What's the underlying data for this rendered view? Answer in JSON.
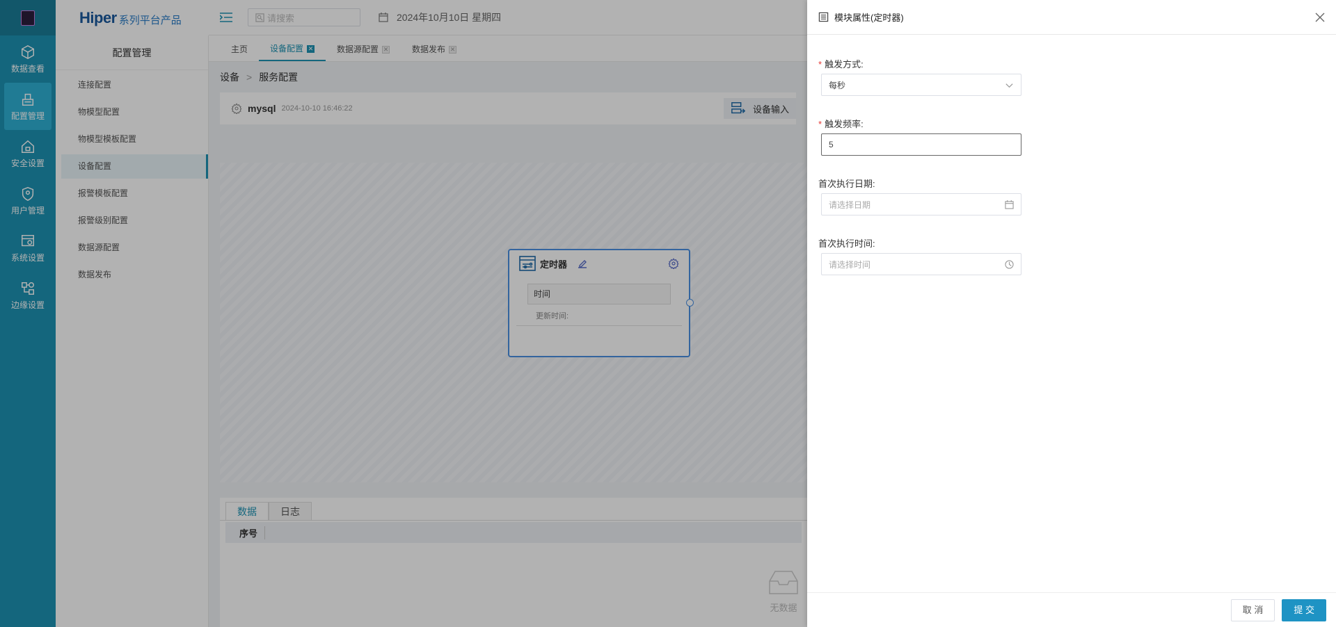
{
  "brand": {
    "title": "Hiper",
    "subtitle": "系列平台产品"
  },
  "rail": {
    "items": [
      {
        "label": "数据查看",
        "icon": "cube-icon"
      },
      {
        "label": "配置管理",
        "icon": "config-icon",
        "active": true
      },
      {
        "label": "安全设置",
        "icon": "home-lock-icon"
      },
      {
        "label": "用户管理",
        "icon": "shield-user-icon"
      },
      {
        "label": "系统设置",
        "icon": "system-gear-icon"
      },
      {
        "label": "边缘设置",
        "icon": "edge-nodes-icon"
      }
    ]
  },
  "header": {
    "search_placeholder": "请搜索",
    "date": "2024年10月10日 星期四"
  },
  "subnav": {
    "title": "配置管理",
    "items": [
      {
        "label": "连接配置"
      },
      {
        "label": "物模型配置"
      },
      {
        "label": "物模型模板配置"
      },
      {
        "label": "设备配置",
        "active": true
      },
      {
        "label": "报警模板配置"
      },
      {
        "label": "报警级别配置"
      },
      {
        "label": "数据源配置"
      },
      {
        "label": "数据发布"
      }
    ]
  },
  "tabs": [
    {
      "label": "主页"
    },
    {
      "label": "设备配置",
      "active": true
    },
    {
      "label": "数据源配置"
    },
    {
      "label": "数据发布"
    }
  ],
  "breadcrumb": {
    "root": "设备",
    "current": "服务配置"
  },
  "device": {
    "name": "mysql",
    "timestamp": "2024-10-10 16:46:22",
    "input_label": "设备输入"
  },
  "node": {
    "title": "定时器",
    "field": "时间",
    "updated_label": "更新时间:"
  },
  "bottom": {
    "tabs": [
      {
        "label": "数据",
        "active": true
      },
      {
        "label": "日志"
      }
    ],
    "column": "序号",
    "empty_text": "无数据"
  },
  "drawer": {
    "title": "模块属性(定时器)",
    "fields": {
      "trigger_mode": {
        "label": "触发方式:",
        "required": true,
        "value": "每秒"
      },
      "trigger_freq": {
        "label": "触发频率:",
        "required": true,
        "value": "5"
      },
      "first_date": {
        "label": "首次执行日期:",
        "placeholder": "请选择日期"
      },
      "first_time": {
        "label": "首次执行时间:",
        "placeholder": "请选择时间"
      }
    },
    "cancel_label": "取 消",
    "submit_label": "提 交"
  },
  "colors": {
    "rail": "#1e93b3",
    "accent": "#1e93c4",
    "required": "#e53935"
  }
}
